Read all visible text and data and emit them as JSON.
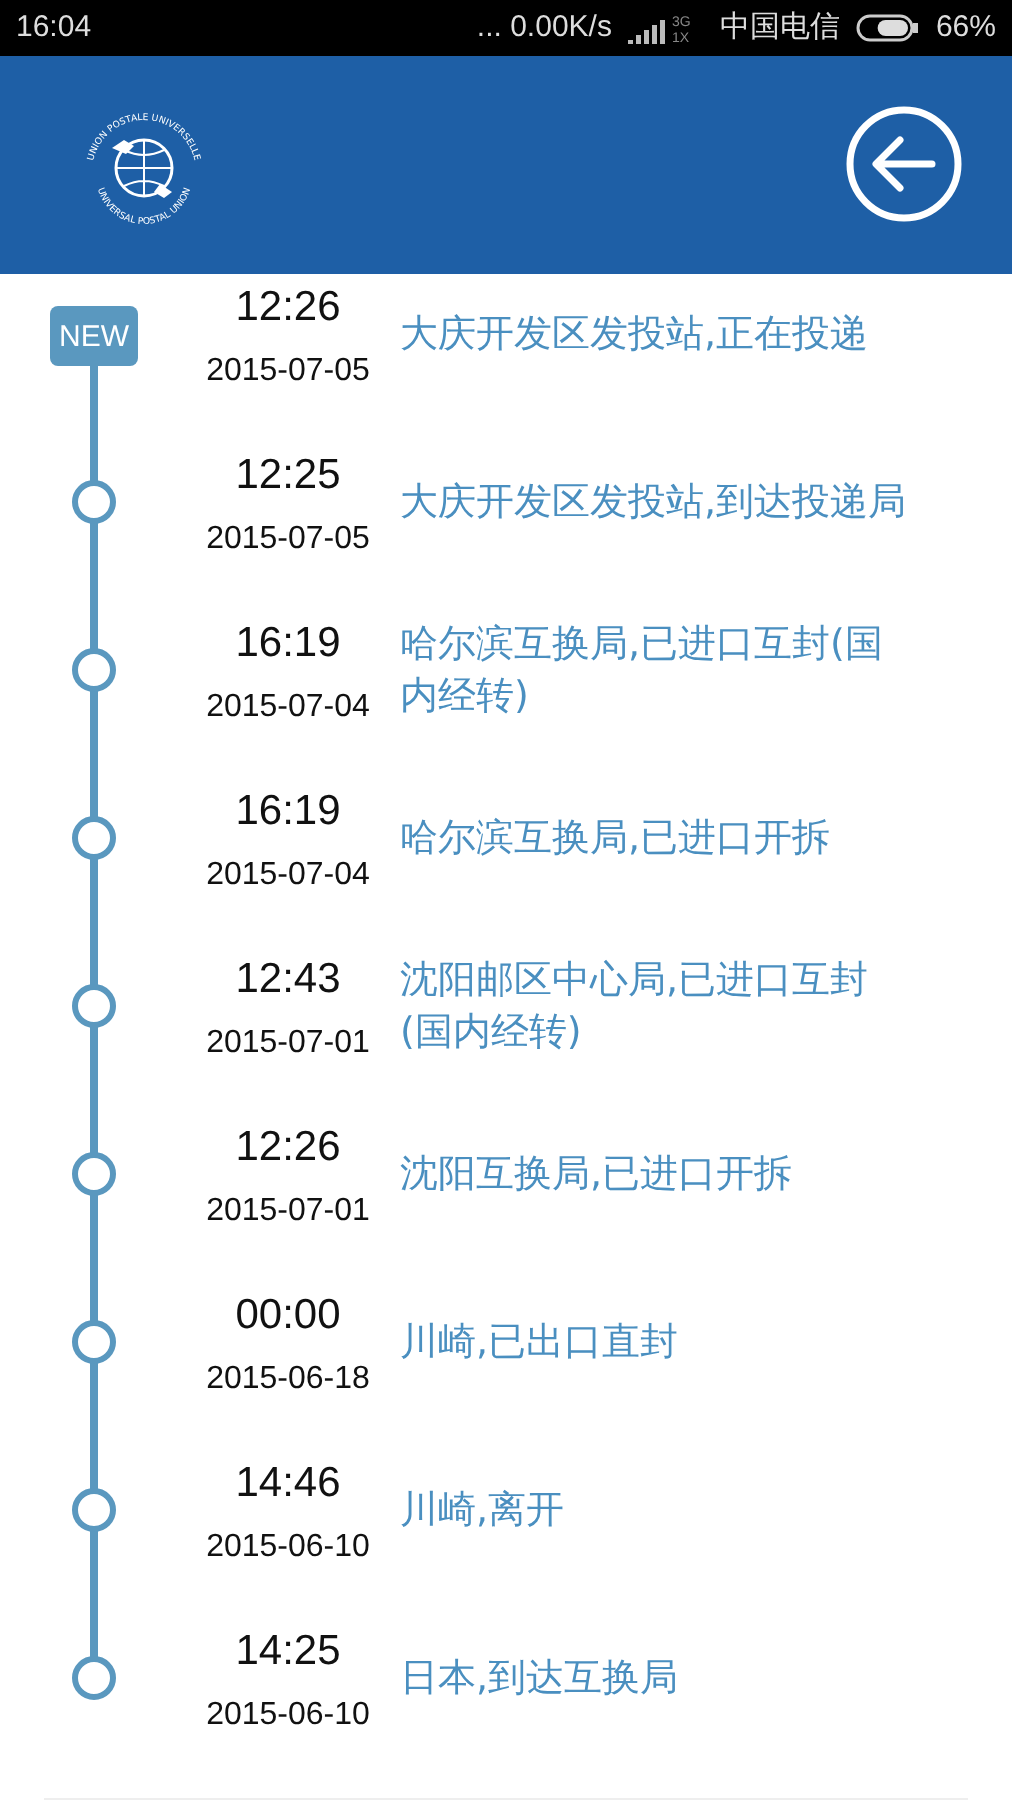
{
  "status_bar": {
    "time": "16:04",
    "speed": "... 0.00K/s",
    "network_type": "3G",
    "network_sub": "1X",
    "carrier": "中国电信",
    "battery": {
      "level": 0.66,
      "percent": "66%"
    }
  },
  "header": {
    "logo_top": "UNION POSTALE UNIVERSELLE",
    "logo_bottom": "UNIVERSAL POSTAL UNION"
  },
  "events": [
    {
      "kind": "new",
      "badge": "NEW",
      "time": "12:26",
      "date": "2015-07-05",
      "text": "大庆开发区发投站,正在投递"
    },
    {
      "kind": "node",
      "time": "12:25",
      "date": "2015-07-05",
      "text": "大庆开发区发投站,到达投递局"
    },
    {
      "kind": "node",
      "time": "16:19",
      "date": "2015-07-04",
      "text": "哈尔滨互换局,已进口互封(国内经转)"
    },
    {
      "kind": "node",
      "time": "16:19",
      "date": "2015-07-04",
      "text": "哈尔滨互换局,已进口开拆"
    },
    {
      "kind": "node",
      "time": "12:43",
      "date": "2015-07-01",
      "text": "沈阳邮区中心局,已进口互封(国内经转)"
    },
    {
      "kind": "node",
      "time": "12:26",
      "date": "2015-07-01",
      "text": "沈阳互换局,已进口开拆"
    },
    {
      "kind": "node",
      "time": "00:00",
      "date": "2015-06-18",
      "text": "川崎,已出口直封"
    },
    {
      "kind": "node",
      "time": "14:46",
      "date": "2015-06-10",
      "text": "川崎,离开"
    },
    {
      "kind": "node",
      "time": "14:25",
      "date": "2015-06-10",
      "text": "日本,到达互换局"
    }
  ]
}
